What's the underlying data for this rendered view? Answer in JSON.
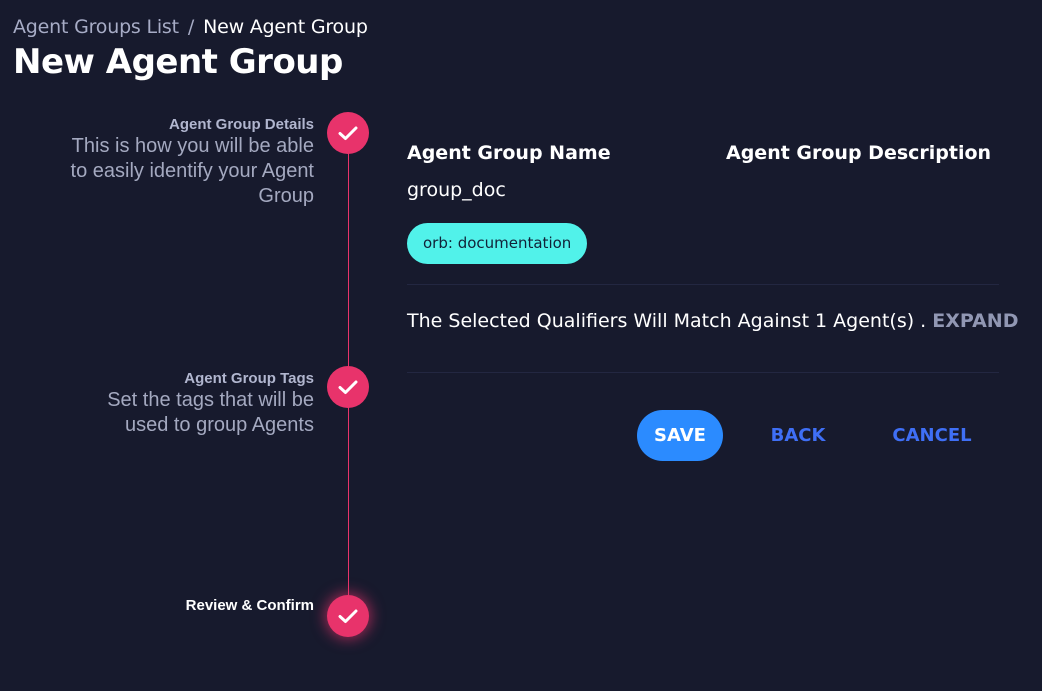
{
  "breadcrumb": {
    "parent": "Agent Groups List",
    "separator": "/",
    "current": "New Agent Group"
  },
  "page_title": "New Agent Group",
  "steps": [
    {
      "title": "Agent Group Details",
      "description_lines": [
        "This is how you will be able",
        "to easily identify your Agent",
        "Group"
      ],
      "status": "completed",
      "icon": "check-icon"
    },
    {
      "title": "Agent Group Tags",
      "description_lines": [
        "Set the tags that will be",
        "used to group Agents"
      ],
      "status": "completed",
      "icon": "check-icon"
    },
    {
      "title": "Review & Confirm",
      "status": "active",
      "icon": "check-icon"
    }
  ],
  "review": {
    "name_label": "Agent Group Name",
    "name_value": "group_doc",
    "description_label": "Agent Group Description",
    "tags": [
      "orb: documentation"
    ],
    "qualifier_text": "The Selected Qualifiers Will Match Against 1 Agent(s) .",
    "expand_label": "EXPAND"
  },
  "actions": {
    "save": "SAVE",
    "back": "BACK",
    "cancel": "CANCEL"
  },
  "colors": {
    "background": "#171a2d",
    "step_accent": "#e8336b",
    "tag_chip": "#51f2ea",
    "primary_button": "#2b8bff",
    "link_button": "#3f6ff5"
  }
}
